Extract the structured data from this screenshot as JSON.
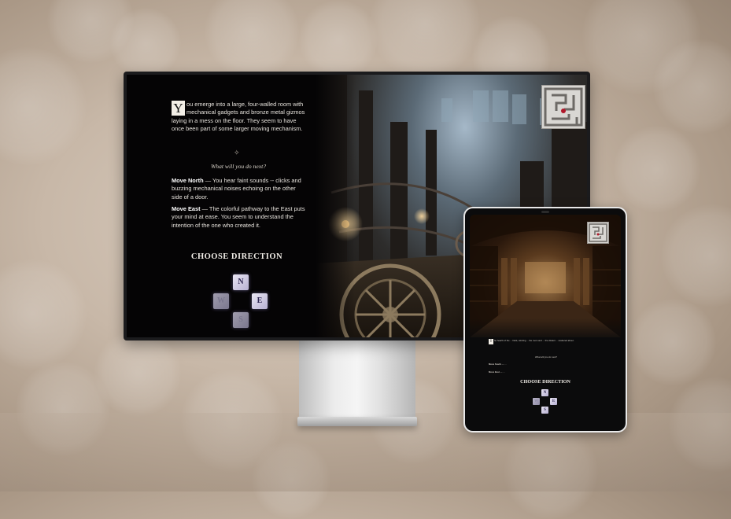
{
  "colors": {
    "accent": "#b7b0d2",
    "dropcap_bg": "#f3efe7",
    "screen_bg": "#050405"
  },
  "desktop": {
    "dropcap": "Y",
    "story": "ou emerge into a large, four-walled room with mechanical gadgets and bronze metal gizmos laying in a mess on the floor. They seem to have once been part of some larger moving mechanism.",
    "separator": "✧",
    "prompt": "What will you do next?",
    "options": [
      {
        "label": "Move North",
        "text": " — You hear faint sounds -- clicks and buzzing mechanical noises echoing on the other side of a door."
      },
      {
        "label": "Move East",
        "text": " — The colorful pathway to the East puts your mind at ease. You seem to understand the intention of the one who created it."
      }
    ],
    "choose_title": "CHOOSE DIRECTION",
    "directions": {
      "north": "N",
      "west": "W",
      "east": "E",
      "south": "S"
    },
    "scene_icon": "steampunk-machine-room-image",
    "map_icon": "maze-map-icon"
  },
  "tablet": {
    "dropcap": "T",
    "story": "he hearth of the ... Dark, winding ... the room and ... the distant ... scattered about.",
    "prompt": "What will you do next?",
    "options": [
      {
        "label": "Move South",
        "text": " — ..."
      },
      {
        "label": "Move East",
        "text": " — ..."
      }
    ],
    "choose_title": "CHOOSE DIRECTION",
    "directions": {
      "north": "N",
      "west": "W",
      "east": "E",
      "south": "S"
    },
    "scene_icon": "library-hall-image",
    "map_icon": "maze-map-icon"
  }
}
